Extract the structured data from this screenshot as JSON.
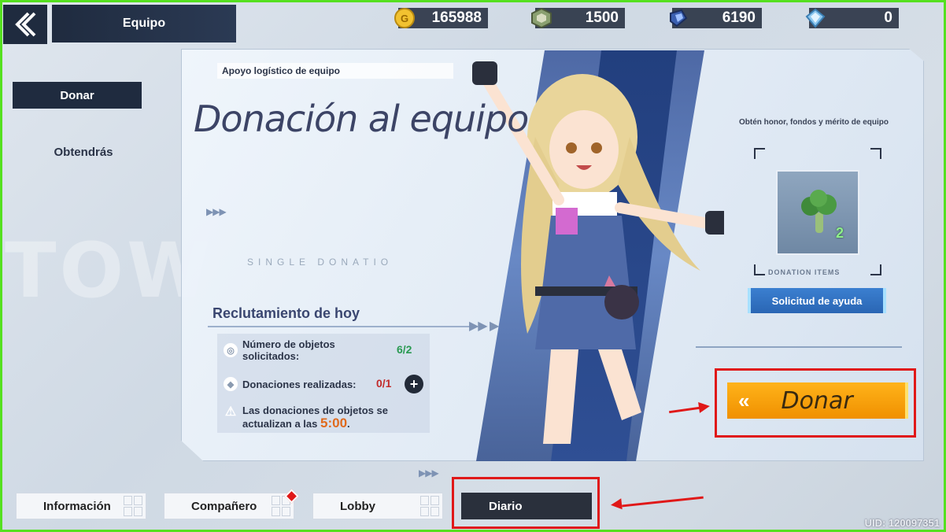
{
  "header": {
    "title": "Equipo",
    "currencies": [
      {
        "icon": "gold-coin-icon",
        "value": "165988"
      },
      {
        "icon": "green-cube-icon",
        "value": "1500"
      },
      {
        "icon": "blue-crystal-icon",
        "value": "6190"
      },
      {
        "icon": "diamond-icon",
        "value": "0"
      }
    ]
  },
  "sidebar": {
    "donar": "Donar",
    "obtendras": "Obtendrás"
  },
  "panel": {
    "tag": "Apoyo logístico de equipo",
    "title": "Donación al equipo",
    "watermark": "SINGLE DONATIO",
    "recruitment": {
      "title": "Reclutamiento de hoy",
      "requested_label": "Número de objetos solicitados:",
      "requested_value": "6/2",
      "donations_label": "Donaciones realizadas:",
      "donations_value": "0/1",
      "notice_text": "Las donaciones de objetos se actualizan a las",
      "notice_time": "5:00",
      "notice_end": "."
    },
    "reward": {
      "description": "Obtén honor, fondos y mérito de equipo",
      "item_count": "2",
      "items_label": "DONATION ITEMS",
      "help_button": "Solicitud de ayuda"
    },
    "donate_button": "Donar"
  },
  "tabs": [
    {
      "label": "Información"
    },
    {
      "label": "Compañero"
    },
    {
      "label": "Lobby"
    },
    {
      "label": "Diario"
    }
  ],
  "background_text": "TOW",
  "uid": "UID: 120097351",
  "colors": {
    "accent": "#f09000",
    "dark": "#1f2b3f",
    "highlight_red": "#e01818",
    "frame_green": "#55e020"
  }
}
